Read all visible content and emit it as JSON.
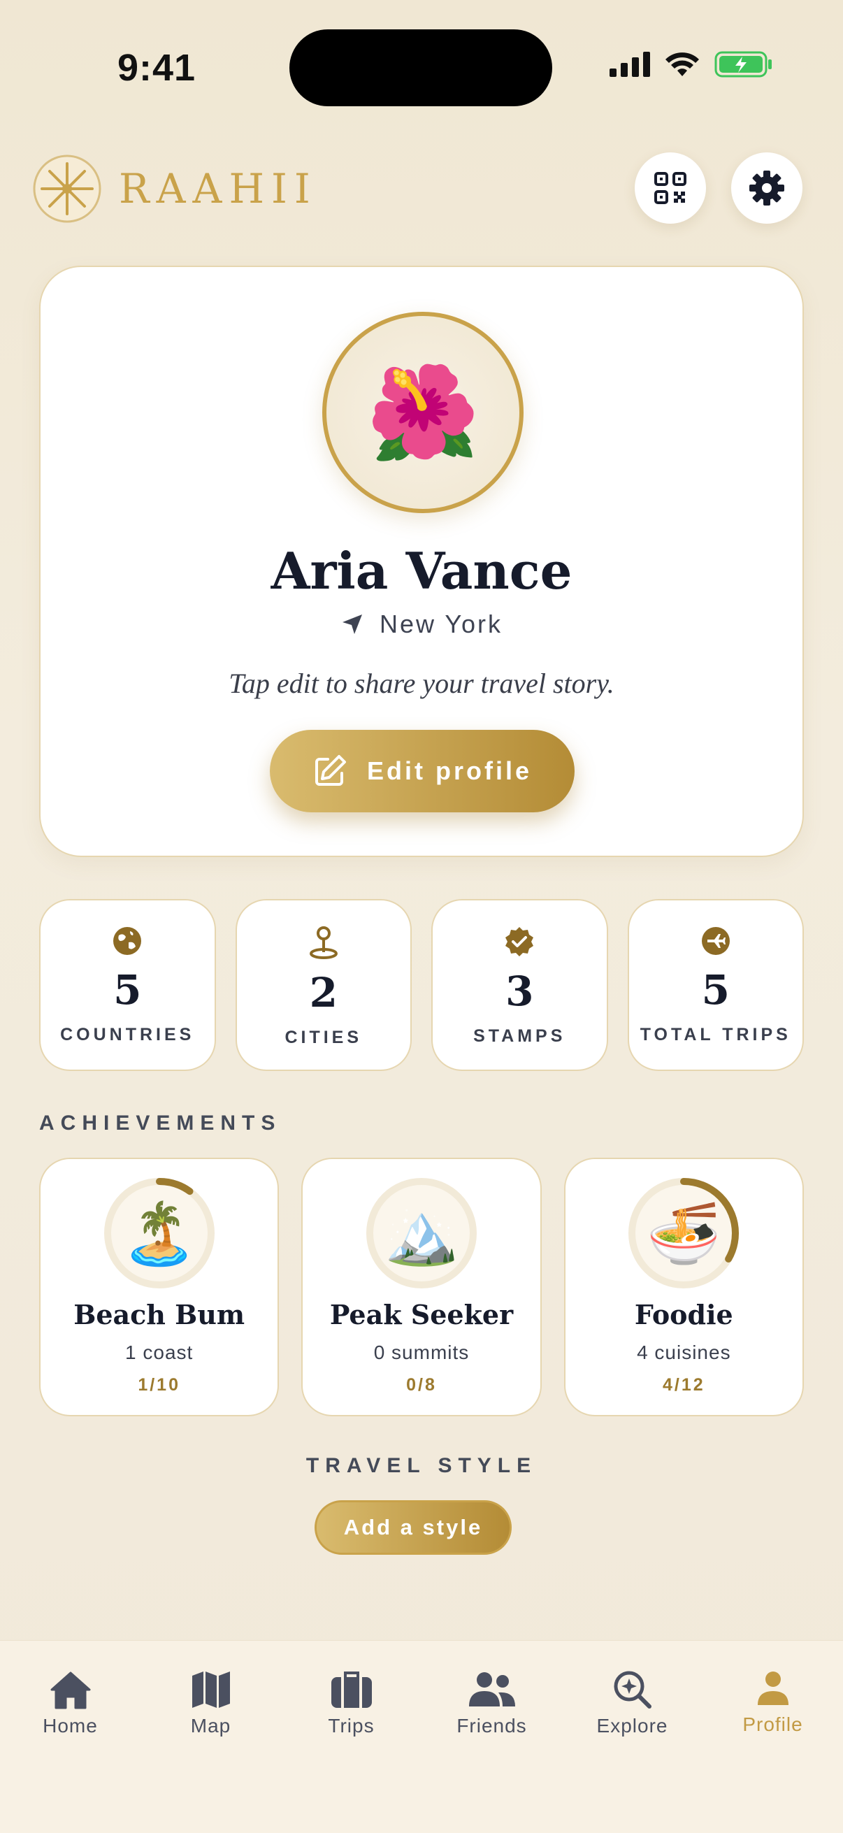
{
  "status_bar": {
    "time": "9:41"
  },
  "header": {
    "brand": "RAAHII"
  },
  "profile": {
    "avatar_emoji": "🌺",
    "name": "Aria Vance",
    "location": "New York",
    "bio": "Tap edit to share your travel story.",
    "edit_label": "Edit profile"
  },
  "stats": [
    {
      "icon": "globe-icon",
      "value": "5",
      "label": "COUNTRIES"
    },
    {
      "icon": "map-pin-icon",
      "value": "2",
      "label": "CITIES"
    },
    {
      "icon": "verified-badge-icon",
      "value": "3",
      "label": "STAMPS"
    },
    {
      "icon": "airplane-icon",
      "value": "5",
      "label": "TOTAL TRIPS"
    }
  ],
  "achievements_title": "ACHIEVEMENTS",
  "achievements": [
    {
      "emoji": "🏝️",
      "title": "Beach Bum",
      "subtitle": "1 coast",
      "progress": "1/10",
      "fraction": 0.1
    },
    {
      "emoji": "🏔️",
      "title": "Peak Seeker",
      "subtitle": "0 summits",
      "progress": "0/8",
      "fraction": 0
    },
    {
      "emoji": "🍜",
      "title": "Foodie",
      "subtitle": "4 cuisines",
      "progress": "4/12",
      "fraction": 0.333
    }
  ],
  "travel_style": {
    "title": "TRAVEL STYLE",
    "button_label": "Add a style"
  },
  "tabs": [
    {
      "label": "Home",
      "icon": "home-icon",
      "active": false
    },
    {
      "label": "Map",
      "icon": "map-icon",
      "active": false
    },
    {
      "label": "Trips",
      "icon": "suitcase-icon",
      "active": false
    },
    {
      "label": "Friends",
      "icon": "friends-icon",
      "active": false
    },
    {
      "label": "Explore",
      "icon": "explore-icon",
      "active": false
    },
    {
      "label": "Profile",
      "icon": "person-icon",
      "active": true
    }
  ],
  "colors": {
    "accent": "#c9a24a",
    "accent_dark": "#8c6a24",
    "ink": "#161b2b",
    "tab_inactive": "#4b5060",
    "battery": "#3ec45a"
  }
}
